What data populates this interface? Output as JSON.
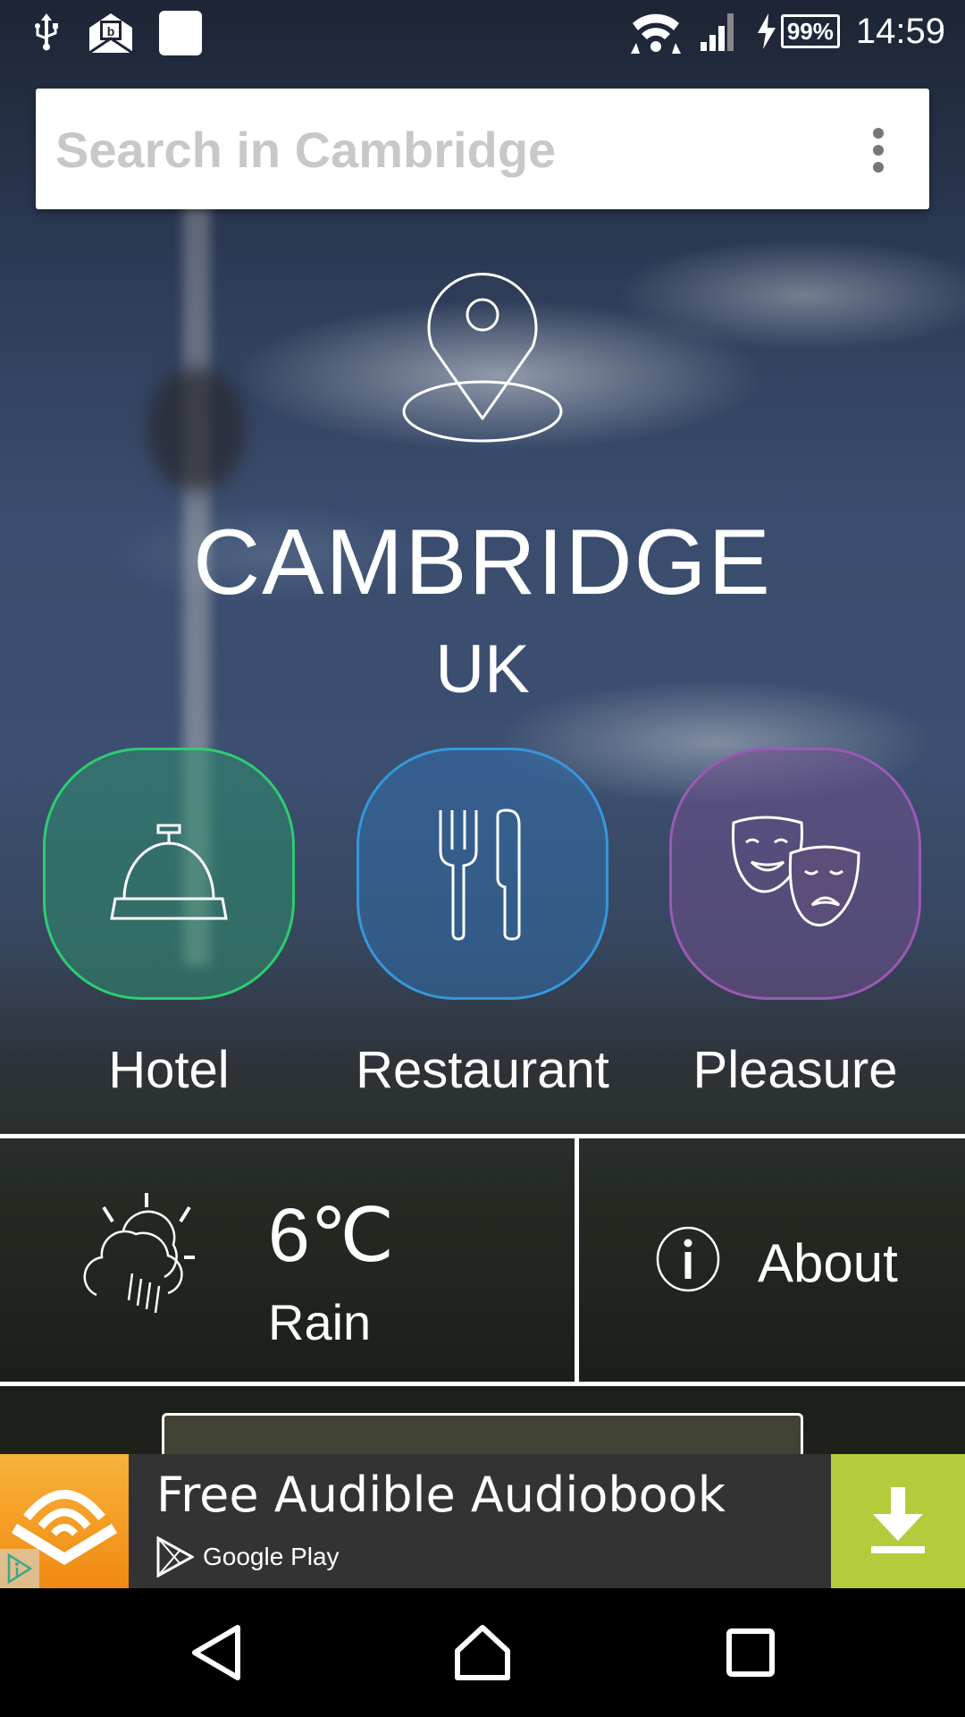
{
  "status_bar": {
    "icons_left": [
      "usb-icon",
      "mail-notification-icon",
      "app-notification-icon"
    ],
    "icons_right": [
      "wifi-icon",
      "cell-signal-icon",
      "charging-icon"
    ],
    "battery": "99%",
    "time": "14:59"
  },
  "search": {
    "placeholder": "Search in Cambridge",
    "value": "",
    "menu_icon": "more-vert-icon"
  },
  "location": {
    "icon": "map-pin-icon",
    "city": "CAMBRIDGE",
    "country": "UK"
  },
  "categories": [
    {
      "label": "Hotel",
      "icon": "service-bell-icon",
      "color": "#2ecc71"
    },
    {
      "label": "Restaurant",
      "icon": "fork-knife-icon",
      "color": "#3498db"
    },
    {
      "label": "Pleasure",
      "icon": "theater-masks-icon",
      "color": "#9b59b6"
    }
  ],
  "weather": {
    "icon": "sun-cloud-rain-icon",
    "temperature": "6℃",
    "condition": "Rain"
  },
  "about": {
    "icon": "info-icon",
    "label": "About"
  },
  "ad": {
    "title": "Free Audible Audiobook",
    "store": "Google Play",
    "logo_color": "#f39c12",
    "download_color": "#b4cc3c"
  },
  "nav": {
    "back": "back-icon",
    "home": "home-icon",
    "recents": "recents-icon"
  }
}
